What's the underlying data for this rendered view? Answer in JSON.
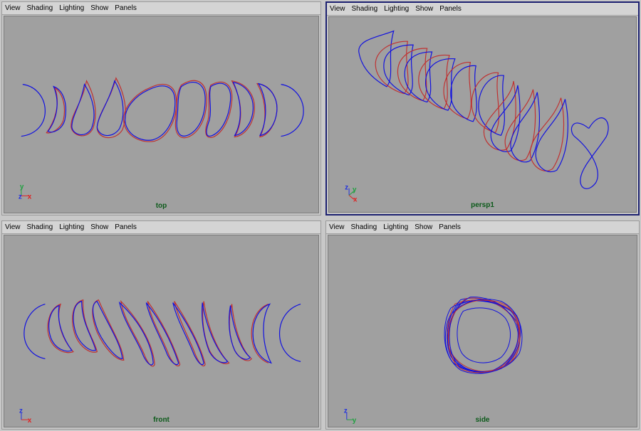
{
  "menu": [
    "View",
    "Shading",
    "Lighting",
    "Show",
    "Panels"
  ],
  "panels": {
    "top": {
      "camera": "top",
      "axes": [
        "y",
        "z",
        "x"
      ]
    },
    "persp": {
      "camera": "persp1",
      "axes": [
        "z",
        "y",
        "x"
      ]
    },
    "front": {
      "camera": "front",
      "axes": [
        "z",
        "x"
      ]
    },
    "side": {
      "camera": "side",
      "axes": [
        "z",
        "y"
      ]
    }
  },
  "colors": {
    "curve_primary": "#1010e0",
    "curve_secondary": "#c03030",
    "axis_x": "#e02020",
    "axis_y": "#20a040",
    "axis_z": "#2030e0",
    "camera_label": "#0c5a1a",
    "active_border": "#1c2070"
  }
}
